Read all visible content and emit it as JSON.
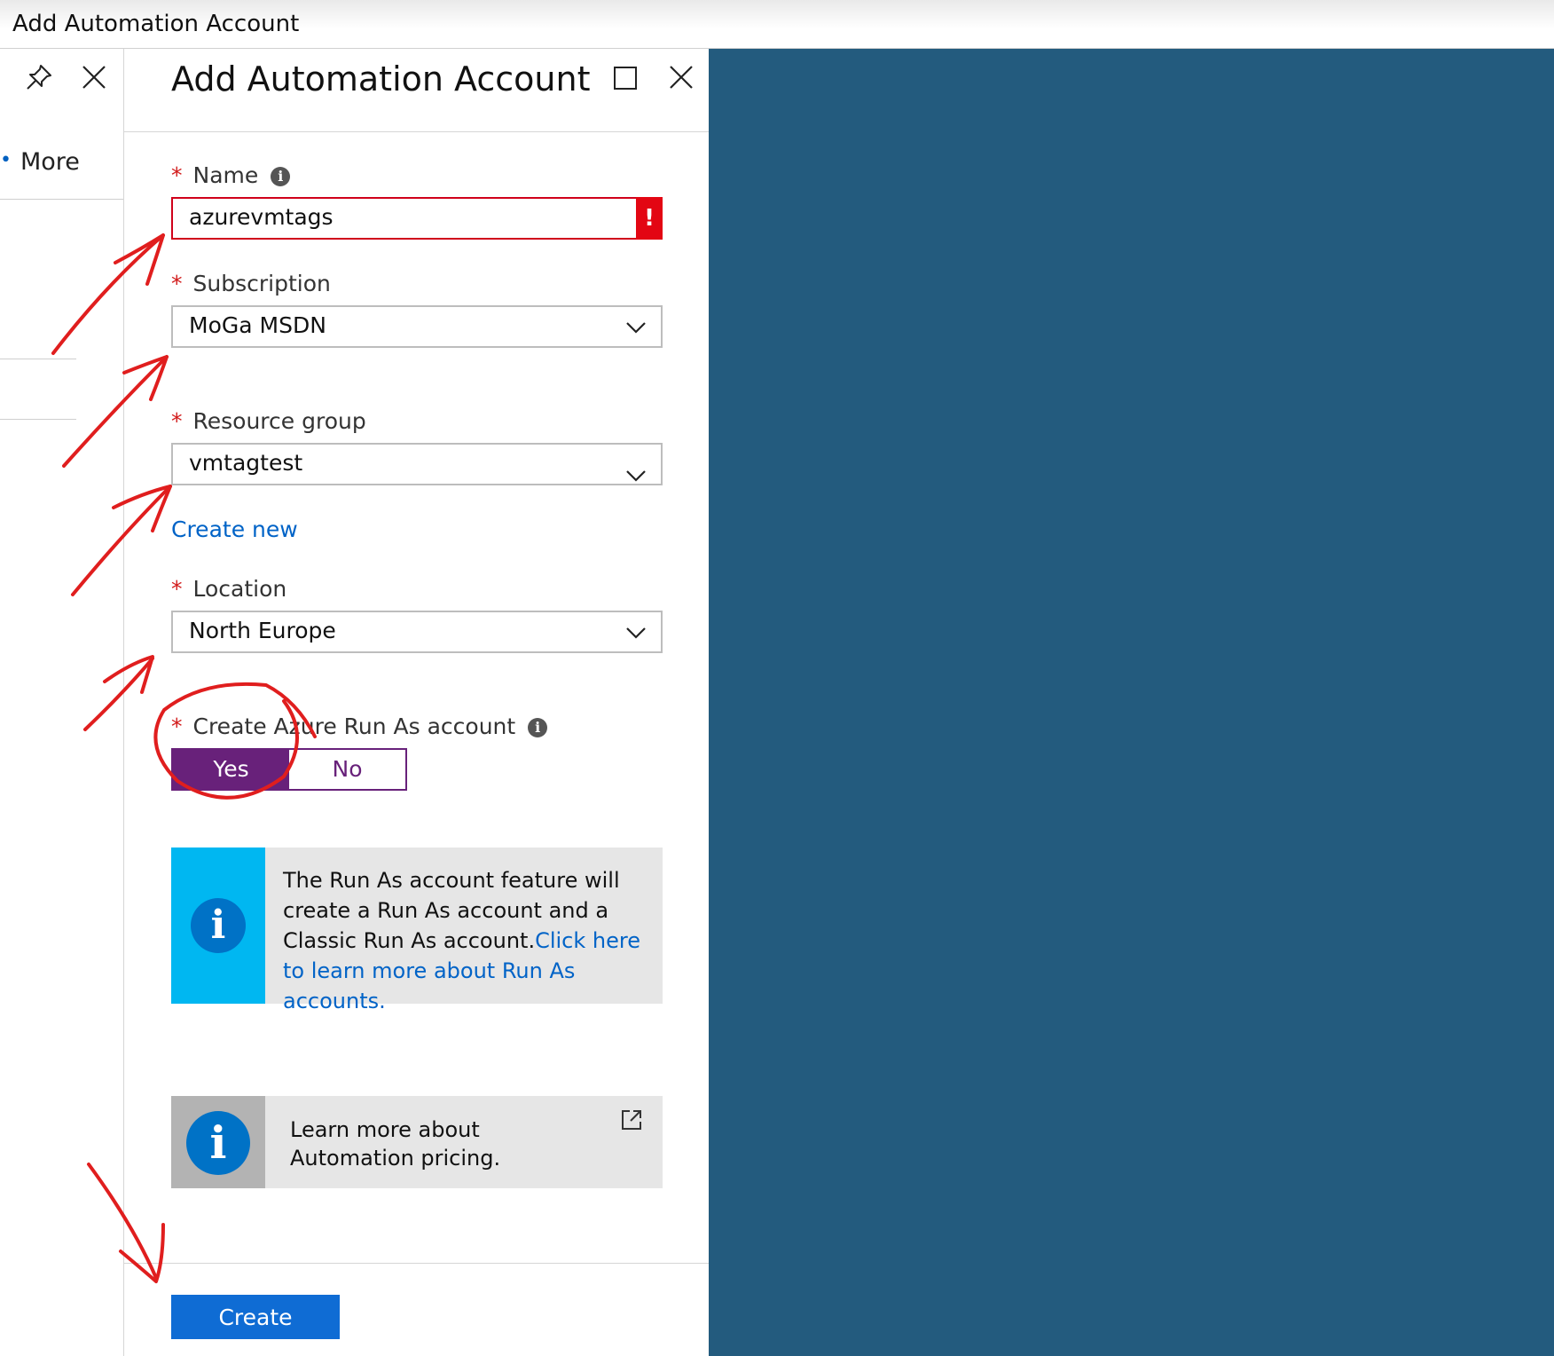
{
  "window": {
    "title": "Add Automation Account"
  },
  "left_blade": {
    "pin_icon": "pin-icon",
    "close_icon": "close-icon",
    "more_label": "More"
  },
  "blade": {
    "title": "Add Automation Account",
    "maximize_icon": "maximize-icon",
    "close_icon": "close-icon"
  },
  "form": {
    "required_marker": "*",
    "name": {
      "label": "Name",
      "value": "azurevmtags",
      "error_marker": "!"
    },
    "subscription": {
      "label": "Subscription",
      "value": "MoGa MSDN"
    },
    "resource_group": {
      "label": "Resource group",
      "value": "vmtagtest",
      "create_new_label": "Create new"
    },
    "location": {
      "label": "Location",
      "value": "North Europe"
    },
    "run_as": {
      "label": "Create Azure Run As account",
      "yes_label": "Yes",
      "no_label": "No",
      "selected": "Yes"
    }
  },
  "run_as_info": {
    "text": "The Run As account feature will create a Run As account and a Classic Run As account.",
    "link_text": "Click here to learn more about Run As accounts."
  },
  "pricing_info": {
    "text": "Learn more about Automation pricing."
  },
  "footer": {
    "create_label": "Create"
  },
  "colors": {
    "accent_blue": "#0f6cd4",
    "link_blue": "#0063c7",
    "toggle_purple": "#68217a",
    "error_red": "#e30613",
    "info_cyan": "#00b7f1",
    "background_blue": "#235b7e",
    "annotation_red": "#e01e1e"
  }
}
